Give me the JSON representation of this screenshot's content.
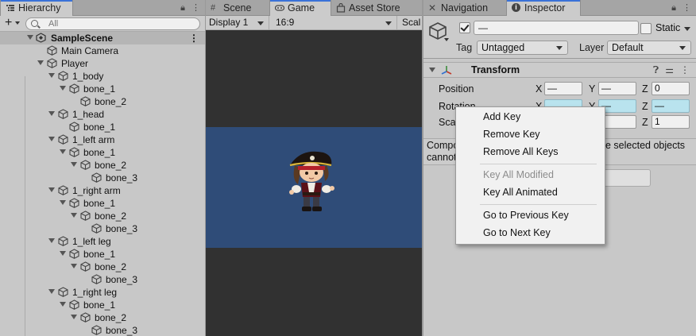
{
  "hierarchy": {
    "tab_label": "Hierarchy",
    "search_placeholder": "All",
    "add_label": "+",
    "scene_name": "SampleScene",
    "scene_menu": "⋮",
    "items": [
      {
        "label": "Main Camera"
      },
      {
        "label": "Player"
      },
      {
        "label": "1_body"
      },
      {
        "label": "bone_1"
      },
      {
        "label": "bone_2"
      },
      {
        "label": "1_head"
      },
      {
        "label": "bone_1"
      },
      {
        "label": "1_left arm"
      },
      {
        "label": "bone_1"
      },
      {
        "label": "bone_2"
      },
      {
        "label": "bone_3"
      },
      {
        "label": "1_right arm"
      },
      {
        "label": "bone_1"
      },
      {
        "label": "bone_2"
      },
      {
        "label": "bone_3"
      },
      {
        "label": "1_left leg"
      },
      {
        "label": "bone_1"
      },
      {
        "label": "bone_2"
      },
      {
        "label": "bone_3"
      },
      {
        "label": "1_right leg"
      },
      {
        "label": "bone_1"
      },
      {
        "label": "bone_2"
      },
      {
        "label": "bone_3"
      }
    ]
  },
  "center_tabs": {
    "scene": "Scene",
    "game": "Game",
    "asset_store": "Asset Store"
  },
  "game_toolbar": {
    "display": "Display 1",
    "aspect": "16:9",
    "scale": "Scal"
  },
  "inspector_tabs": {
    "navigation": "Navigation",
    "inspector": "Inspector"
  },
  "object_header": {
    "name_value": "—",
    "static_label": "Static",
    "tag_label": "Tag",
    "tag_value": "Untagged",
    "layer_label": "Layer",
    "layer_value": "Default"
  },
  "transform": {
    "title": "Transform",
    "position_label": "Position",
    "rotation_label": "Rotation",
    "scale_label": "Scale",
    "position": {
      "x": "—",
      "y": "—",
      "z": "0"
    },
    "rotation": {
      "x": "",
      "y": "—",
      "z": "—"
    },
    "scale": {
      "x": "",
      "y": "",
      "z": "1"
    }
  },
  "help": {
    "line1_start": "Compo",
    "line1_end": "e selected objects",
    "line2_start": "cannot"
  },
  "context_menu": {
    "add_key": "Add Key",
    "remove_key": "Remove Key",
    "remove_all_keys": "Remove All Keys",
    "key_all_modified": "Key All Modified",
    "key_all_animated": "Key All Animated",
    "go_previous_key": "Go to Previous Key",
    "go_next_key": "Go to Next Key"
  },
  "colors": {
    "accent": "#3a72d8",
    "game_background": "#313131",
    "camera_background": "#2f4c78",
    "animated_field": "#b9e3ee"
  }
}
